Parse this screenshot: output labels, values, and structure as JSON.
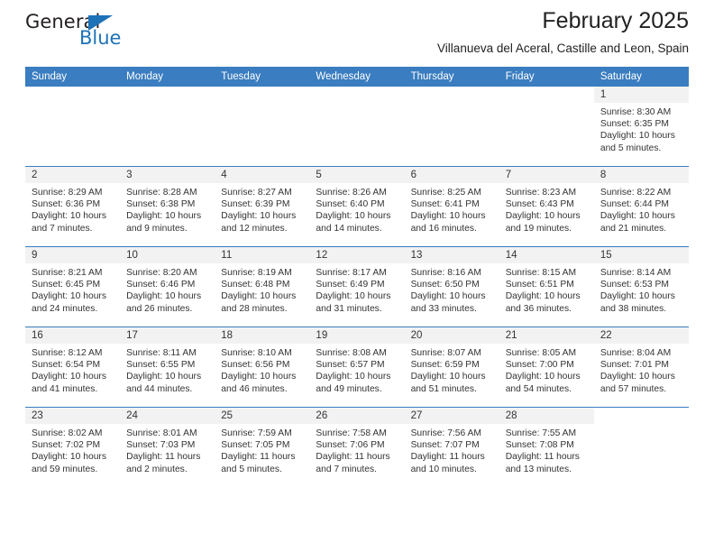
{
  "logo": {
    "word_top": "General",
    "word_bottom": "Blue",
    "triangle_icon": "blue-triangle-icon",
    "blue": "#1e72b8"
  },
  "header": {
    "title": "February 2025",
    "subtitle": "Villanueva del Aceral, Castille and Leon, Spain"
  },
  "theme": {
    "header_blue": "#3a7dc0",
    "daynum_band": "#f2f2f2",
    "text": "#333333"
  },
  "weekday_headers": [
    "Sunday",
    "Monday",
    "Tuesday",
    "Wednesday",
    "Thursday",
    "Friday",
    "Saturday"
  ],
  "labels": {
    "sunrise": "Sunrise:",
    "sunset": "Sunset:",
    "daylight": "Daylight:"
  },
  "weeks": [
    [
      {
        "day": "",
        "blank": true
      },
      {
        "day": "",
        "blank": true
      },
      {
        "day": "",
        "blank": true
      },
      {
        "day": "",
        "blank": true
      },
      {
        "day": "",
        "blank": true
      },
      {
        "day": "",
        "blank": true
      },
      {
        "day": "1",
        "sunrise": "Sunrise: 8:30 AM",
        "sunset": "Sunset: 6:35 PM",
        "daylight_1": "Daylight: 10 hours",
        "daylight_2": "and 5 minutes."
      }
    ],
    [
      {
        "day": "2",
        "sunrise": "Sunrise: 8:29 AM",
        "sunset": "Sunset: 6:36 PM",
        "daylight_1": "Daylight: 10 hours",
        "daylight_2": "and 7 minutes."
      },
      {
        "day": "3",
        "sunrise": "Sunrise: 8:28 AM",
        "sunset": "Sunset: 6:38 PM",
        "daylight_1": "Daylight: 10 hours",
        "daylight_2": "and 9 minutes."
      },
      {
        "day": "4",
        "sunrise": "Sunrise: 8:27 AM",
        "sunset": "Sunset: 6:39 PM",
        "daylight_1": "Daylight: 10 hours",
        "daylight_2": "and 12 minutes."
      },
      {
        "day": "5",
        "sunrise": "Sunrise: 8:26 AM",
        "sunset": "Sunset: 6:40 PM",
        "daylight_1": "Daylight: 10 hours",
        "daylight_2": "and 14 minutes."
      },
      {
        "day": "6",
        "sunrise": "Sunrise: 8:25 AM",
        "sunset": "Sunset: 6:41 PM",
        "daylight_1": "Daylight: 10 hours",
        "daylight_2": "and 16 minutes."
      },
      {
        "day": "7",
        "sunrise": "Sunrise: 8:23 AM",
        "sunset": "Sunset: 6:43 PM",
        "daylight_1": "Daylight: 10 hours",
        "daylight_2": "and 19 minutes."
      },
      {
        "day": "8",
        "sunrise": "Sunrise: 8:22 AM",
        "sunset": "Sunset: 6:44 PM",
        "daylight_1": "Daylight: 10 hours",
        "daylight_2": "and 21 minutes."
      }
    ],
    [
      {
        "day": "9",
        "sunrise": "Sunrise: 8:21 AM",
        "sunset": "Sunset: 6:45 PM",
        "daylight_1": "Daylight: 10 hours",
        "daylight_2": "and 24 minutes."
      },
      {
        "day": "10",
        "sunrise": "Sunrise: 8:20 AM",
        "sunset": "Sunset: 6:46 PM",
        "daylight_1": "Daylight: 10 hours",
        "daylight_2": "and 26 minutes."
      },
      {
        "day": "11",
        "sunrise": "Sunrise: 8:19 AM",
        "sunset": "Sunset: 6:48 PM",
        "daylight_1": "Daylight: 10 hours",
        "daylight_2": "and 28 minutes."
      },
      {
        "day": "12",
        "sunrise": "Sunrise: 8:17 AM",
        "sunset": "Sunset: 6:49 PM",
        "daylight_1": "Daylight: 10 hours",
        "daylight_2": "and 31 minutes."
      },
      {
        "day": "13",
        "sunrise": "Sunrise: 8:16 AM",
        "sunset": "Sunset: 6:50 PM",
        "daylight_1": "Daylight: 10 hours",
        "daylight_2": "and 33 minutes."
      },
      {
        "day": "14",
        "sunrise": "Sunrise: 8:15 AM",
        "sunset": "Sunset: 6:51 PM",
        "daylight_1": "Daylight: 10 hours",
        "daylight_2": "and 36 minutes."
      },
      {
        "day": "15",
        "sunrise": "Sunrise: 8:14 AM",
        "sunset": "Sunset: 6:53 PM",
        "daylight_1": "Daylight: 10 hours",
        "daylight_2": "and 38 minutes."
      }
    ],
    [
      {
        "day": "16",
        "sunrise": "Sunrise: 8:12 AM",
        "sunset": "Sunset: 6:54 PM",
        "daylight_1": "Daylight: 10 hours",
        "daylight_2": "and 41 minutes."
      },
      {
        "day": "17",
        "sunrise": "Sunrise: 8:11 AM",
        "sunset": "Sunset: 6:55 PM",
        "daylight_1": "Daylight: 10 hours",
        "daylight_2": "and 44 minutes."
      },
      {
        "day": "18",
        "sunrise": "Sunrise: 8:10 AM",
        "sunset": "Sunset: 6:56 PM",
        "daylight_1": "Daylight: 10 hours",
        "daylight_2": "and 46 minutes."
      },
      {
        "day": "19",
        "sunrise": "Sunrise: 8:08 AM",
        "sunset": "Sunset: 6:57 PM",
        "daylight_1": "Daylight: 10 hours",
        "daylight_2": "and 49 minutes."
      },
      {
        "day": "20",
        "sunrise": "Sunrise: 8:07 AM",
        "sunset": "Sunset: 6:59 PM",
        "daylight_1": "Daylight: 10 hours",
        "daylight_2": "and 51 minutes."
      },
      {
        "day": "21",
        "sunrise": "Sunrise: 8:05 AM",
        "sunset": "Sunset: 7:00 PM",
        "daylight_1": "Daylight: 10 hours",
        "daylight_2": "and 54 minutes."
      },
      {
        "day": "22",
        "sunrise": "Sunrise: 8:04 AM",
        "sunset": "Sunset: 7:01 PM",
        "daylight_1": "Daylight: 10 hours",
        "daylight_2": "and 57 minutes."
      }
    ],
    [
      {
        "day": "23",
        "sunrise": "Sunrise: 8:02 AM",
        "sunset": "Sunset: 7:02 PM",
        "daylight_1": "Daylight: 10 hours",
        "daylight_2": "and 59 minutes."
      },
      {
        "day": "24",
        "sunrise": "Sunrise: 8:01 AM",
        "sunset": "Sunset: 7:03 PM",
        "daylight_1": "Daylight: 11 hours",
        "daylight_2": "and 2 minutes."
      },
      {
        "day": "25",
        "sunrise": "Sunrise: 7:59 AM",
        "sunset": "Sunset: 7:05 PM",
        "daylight_1": "Daylight: 11 hours",
        "daylight_2": "and 5 minutes."
      },
      {
        "day": "26",
        "sunrise": "Sunrise: 7:58 AM",
        "sunset": "Sunset: 7:06 PM",
        "daylight_1": "Daylight: 11 hours",
        "daylight_2": "and 7 minutes."
      },
      {
        "day": "27",
        "sunrise": "Sunrise: 7:56 AM",
        "sunset": "Sunset: 7:07 PM",
        "daylight_1": "Daylight: 11 hours",
        "daylight_2": "and 10 minutes."
      },
      {
        "day": "28",
        "sunrise": "Sunrise: 7:55 AM",
        "sunset": "Sunset: 7:08 PM",
        "daylight_1": "Daylight: 11 hours",
        "daylight_2": "and 13 minutes."
      },
      {
        "day": "",
        "blank": true
      }
    ]
  ]
}
